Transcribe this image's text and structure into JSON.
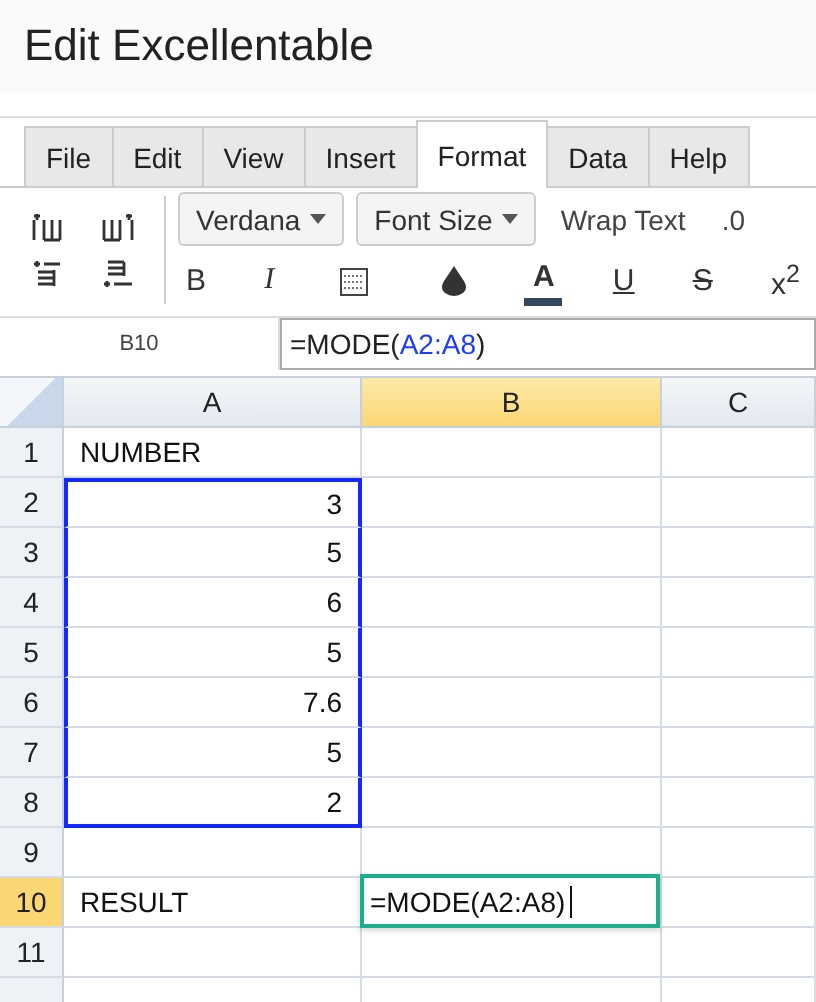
{
  "window": {
    "title": "Edit Excellentable"
  },
  "tabs": [
    {
      "label": "File",
      "selected": false
    },
    {
      "label": "Edit",
      "selected": false
    },
    {
      "label": "View",
      "selected": false
    },
    {
      "label": "Insert",
      "selected": false
    },
    {
      "label": "Format",
      "selected": true
    },
    {
      "label": "Data",
      "selected": false
    },
    {
      "label": "Help",
      "selected": false
    }
  ],
  "toolbar": {
    "dropdowns": [
      "Verdana",
      "Font Size"
    ],
    "wrap_text": "Wrap Text",
    "decimal": ".0",
    "format_buttons": [
      {
        "kind": "bold",
        "label": "B"
      },
      {
        "kind": "italic",
        "label": "I"
      },
      {
        "kind": "borders"
      },
      {
        "kind": "fill"
      },
      {
        "kind": "text_color",
        "label": "A"
      },
      {
        "kind": "underline",
        "label": "U"
      },
      {
        "kind": "strike",
        "label": "S"
      },
      {
        "kind": "superscript",
        "label": "x$^{2}$"
      }
    ]
  },
  "formula_bar": {
    "cell_ref": "B10",
    "prefix": "=MODE(",
    "reference": "A2:A8",
    "suffix": ")"
  },
  "grid": {
    "columns": [
      {
        "label": "A",
        "selected": false
      },
      {
        "label": "B",
        "selected": true
      },
      {
        "label": "C",
        "selected": false
      }
    ],
    "rows": [
      {
        "label": "1",
        "selected": false,
        "in_range": false,
        "a": "NUMBER",
        "a_right_aligned": false
      },
      {
        "label": "2",
        "selected": false,
        "in_range": true,
        "a": "3",
        "a_right_aligned": true
      },
      {
        "label": "3",
        "selected": false,
        "in_range": true,
        "a": "5",
        "a_right_aligned": true
      },
      {
        "label": "4",
        "selected": false,
        "in_range": true,
        "a": "6",
        "a_right_aligned": true
      },
      {
        "label": "5",
        "selected": false,
        "in_range": true,
        "a": "5",
        "a_right_aligned": true
      },
      {
        "label": "6",
        "selected": false,
        "in_range": true,
        "a": "7.6",
        "a_right_aligned": true
      },
      {
        "label": "7",
        "selected": false,
        "in_range": true,
        "a": "5",
        "a_right_aligned": true
      },
      {
        "label": "8",
        "selected": false,
        "in_range": true,
        "a": "2",
        "a_right_aligned": true
      },
      {
        "label": "9",
        "selected": false,
        "in_range": false
      },
      {
        "label": "10",
        "selected": true,
        "in_range": false,
        "a": "RESULT",
        "a_right_aligned": false,
        "b_editor": "=MODE(A2:A8)"
      },
      {
        "label": "11",
        "selected": false,
        "in_range": false
      },
      {
        "selected": false,
        "in_range": false
      }
    ]
  }
}
